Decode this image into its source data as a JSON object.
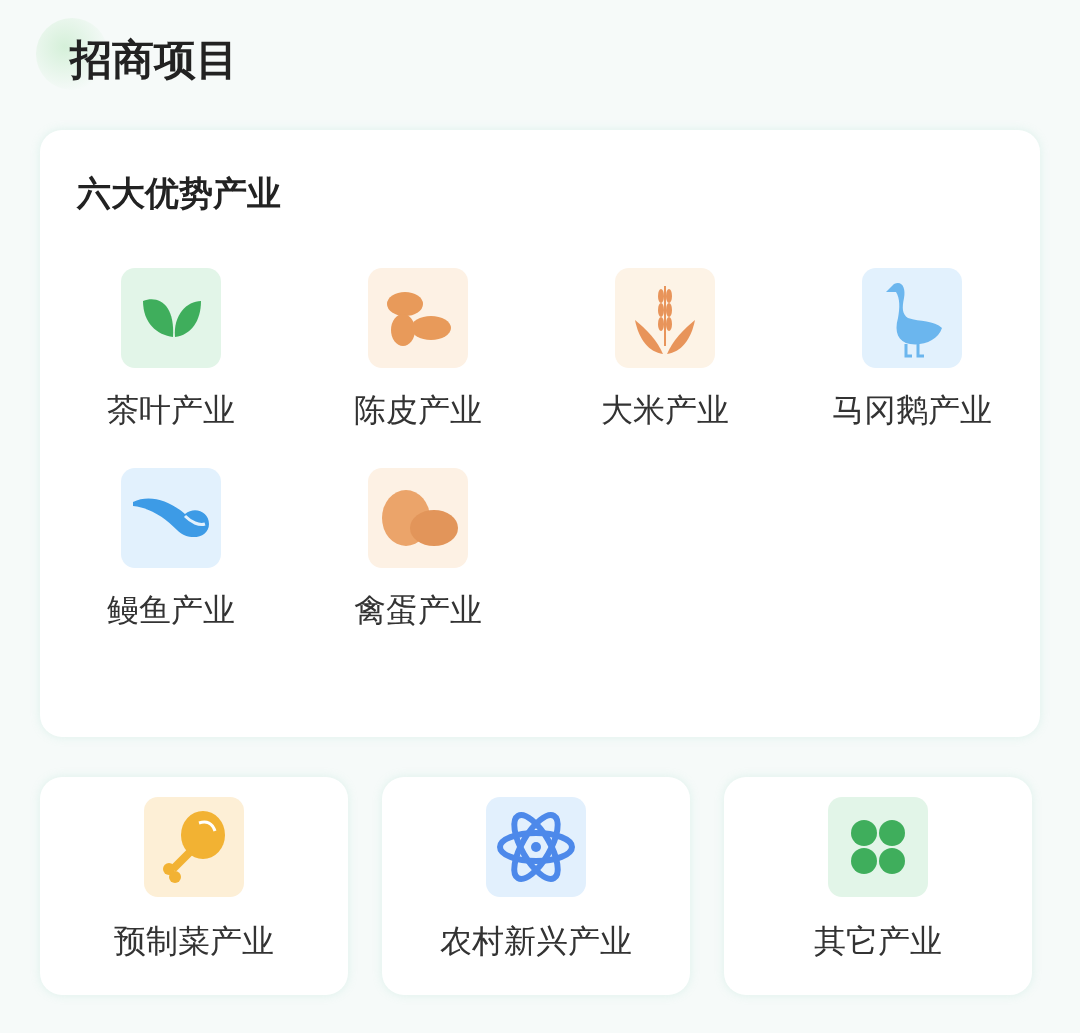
{
  "page_title": "招商项目",
  "featured": {
    "title": "六大优势产业",
    "items": [
      {
        "label": "茶叶产业"
      },
      {
        "label": "陈皮产业"
      },
      {
        "label": "大米产业"
      },
      {
        "label": "马冈鹅产业"
      },
      {
        "label": "鳗鱼产业"
      },
      {
        "label": "禽蛋产业"
      }
    ]
  },
  "other": [
    {
      "label": "预制菜产业"
    },
    {
      "label": "农村新兴产业"
    },
    {
      "label": "其它产业"
    }
  ]
}
